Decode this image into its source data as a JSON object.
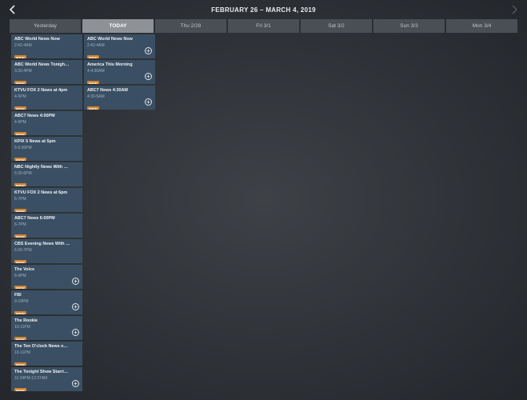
{
  "header": {
    "title": "FEBRUARY 26 – MARCH 4, 2019",
    "back_icon": "chevron-left-icon",
    "next_icon": "chevron-right-icon"
  },
  "tabs": [
    {
      "label": "Yesterday",
      "active": false
    },
    {
      "label": "TODAY",
      "active": true
    },
    {
      "label": "Thu 2/28",
      "active": false
    },
    {
      "label": "Fri 3/1",
      "active": false
    },
    {
      "label": "Sat 3/2",
      "active": false
    },
    {
      "label": "Sun 3/3",
      "active": false
    },
    {
      "label": "Mon 3/4",
      "active": false
    }
  ],
  "badge_label": "NEW",
  "colors": {
    "card_bg": "#3a4f63",
    "badge_bg": "#d2832d",
    "active_tab_bg": "#8e9296",
    "tab_bg": "#4a4f56"
  },
  "yesterday": [
    {
      "title": "ABC World News Now",
      "time": "2:42-4AM",
      "badge": true,
      "record": false
    },
    {
      "title": "ABC World News Tonight With ...",
      "time": "3:30-4PM",
      "badge": true,
      "record": false
    },
    {
      "title": "KTVU FOX 2 News at 4pm",
      "time": "4-5PM",
      "badge": true,
      "record": false
    },
    {
      "title": "ABC7 News 4:00PM",
      "time": "4-5PM",
      "badge": true,
      "record": false
    },
    {
      "title": "KPIX 5 News at 5pm",
      "time": "5-5:30PM",
      "badge": true,
      "record": false
    },
    {
      "title": "NBC Nightly News With Lester...",
      "time": "5:30-6PM",
      "badge": true,
      "record": false
    },
    {
      "title": "KTVU FOX 2 News at 6pm",
      "time": "6-7PM",
      "badge": true,
      "record": false
    },
    {
      "title": "ABC7 News 6:00PM",
      "time": "6-7PM",
      "badge": true,
      "record": false
    },
    {
      "title": "CBS Evening News With Jeff Glor",
      "time": "6:30-7PM",
      "badge": true,
      "record": false
    },
    {
      "title": "The Voice",
      "time": "8-9PM",
      "badge": true,
      "record": true
    },
    {
      "title": "FBI",
      "time": "9-10PM",
      "badge": true,
      "record": true
    },
    {
      "title": "The Rookie",
      "time": "10-11PM",
      "badge": true,
      "record": true
    },
    {
      "title": "The Ten O'clock News on KTVU...",
      "time": "10-11PM",
      "badge": true,
      "record": false
    },
    {
      "title": "The Tonight Show Starring Jim...",
      "time": "11:34PM-12:37AM",
      "badge": true,
      "record": true
    }
  ],
  "today": [
    {
      "title": "ABC World News Now",
      "time": "2:42-4AM",
      "badge": true,
      "record": true
    },
    {
      "title": "America This Morning",
      "time": "4-4:30AM",
      "badge": true,
      "record": true
    },
    {
      "title": "ABC7 News 4:30AM",
      "time": "4:30-5AM",
      "badge": true,
      "record": true
    }
  ]
}
